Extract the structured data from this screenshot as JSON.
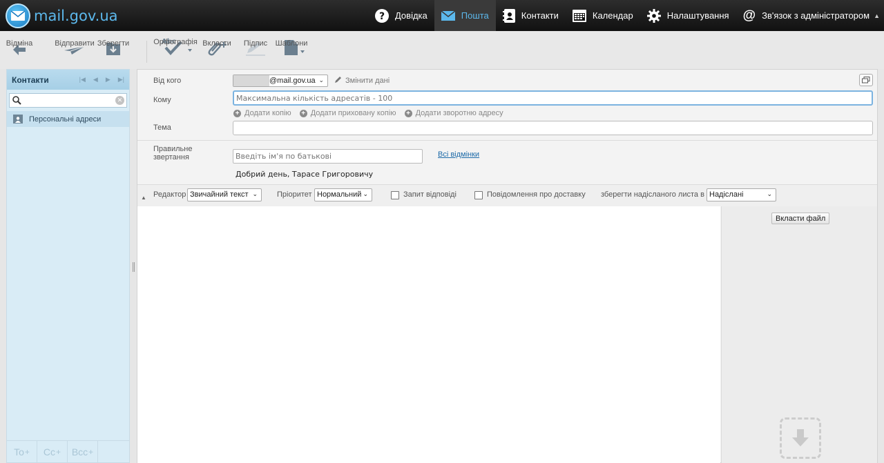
{
  "app": {
    "logo_text": "mail.gov.ua"
  },
  "nav": {
    "help": "Довідка",
    "mail": "Пошта",
    "contacts": "Контакти",
    "calendar": "Календар",
    "settings": "Налаштування",
    "admin": "Зв'язок з адміністратором"
  },
  "toolbar": {
    "cancel": "Відміна",
    "send": "Відправити",
    "save": "Зберегти",
    "spelling": "Орфографія",
    "attach": "Вкласти",
    "signature": "Підпис",
    "templates": "Шаблони",
    "spelling_icon_text": "Abc"
  },
  "contacts": {
    "title": "Контакти",
    "search_value": "",
    "items": [
      {
        "label": "Персональні адреси"
      }
    ],
    "footer": {
      "to": "To",
      "cc": "Cc",
      "bcc": "Bcc",
      "plus": "+"
    }
  },
  "compose": {
    "from_label": "Від кого",
    "from_domain": "@mail.gov.ua",
    "change_data": "Змінити дані",
    "to_label": "Кому",
    "to_placeholder": "Максимальна кількість адресатів - 100",
    "add_cc": "Додати копію",
    "add_bcc": "Додати приховану копію",
    "add_reply_to": "Додати зворотню адресу",
    "subject_label": "Тема",
    "subject_value": "",
    "salutation_label_1": "Правильне",
    "salutation_label_2": "звертання",
    "name_placeholder": "Введіть ім'я по батькові",
    "all_forms": "Всі відмінки",
    "greeting": "Добрий день, Тарасе Григоровичу"
  },
  "options": {
    "editor_label": "Редактор",
    "editor_value": "Звичайний текст",
    "priority_label": "Пріоритет",
    "priority_value": "Нормальний",
    "read_receipt": "Запит відповіді",
    "delivery_notice": "Повідомлення про доставку",
    "save_sent_label": "зберегти надісланого листа в",
    "save_sent_value": "Надіслані"
  },
  "attachments": {
    "attach_file": "Вкласти файл"
  },
  "colors": {
    "accent": "#5cb8ec",
    "topbar": "#1a1a1a",
    "contacts_bg": "#d9ecf6",
    "link": "#1c6aa8"
  }
}
